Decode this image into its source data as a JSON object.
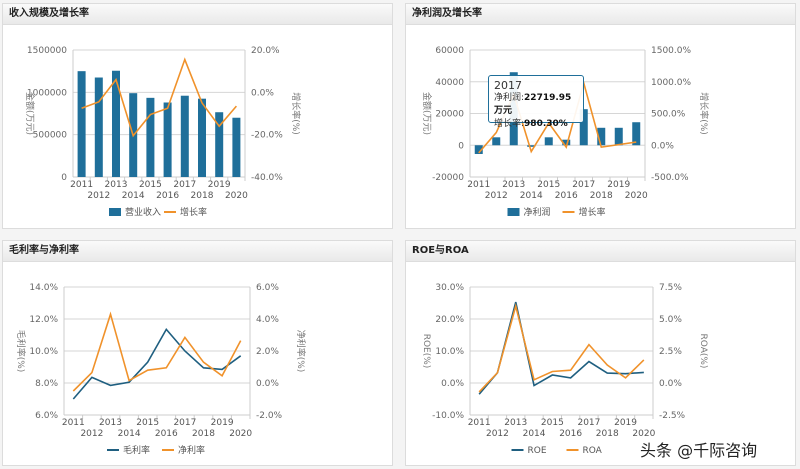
{
  "panels": [
    {
      "title": "收入规模及增长率"
    },
    {
      "title": "净利润及增长率"
    },
    {
      "title": "毛利率与净利率"
    },
    {
      "title": "ROE与ROA"
    }
  ],
  "colors": {
    "bar": "#1f6f9a",
    "line1": "#1f5f80",
    "line2": "#f0922b"
  },
  "chart_data": [
    {
      "type": "bar+line",
      "categories": [
        "2011",
        "2012",
        "2013",
        "2014",
        "2015",
        "2016",
        "2017",
        "2018",
        "2019",
        "2020"
      ],
      "ylabel": "金额(万元)",
      "y2label": "增长率(%)",
      "ylim": [
        0,
        1500000
      ],
      "yticks": [
        "0",
        "500000",
        "1000000",
        "1500000"
      ],
      "y2lim": [
        -40,
        20
      ],
      "y2ticks": [
        "-40.0%",
        "-20.0%",
        "0.0%",
        "20.0%"
      ],
      "legend": "bottom",
      "series": [
        {
          "name": "营业收入",
          "type": "bar",
          "axis": "left",
          "values": [
            1250000,
            1175000,
            1255000,
            990000,
            935000,
            880000,
            960000,
            925000,
            765000,
            700000
          ]
        },
        {
          "name": "增长率",
          "type": "line",
          "axis": "right",
          "values": [
            -7.5,
            -4.5,
            6,
            -20.5,
            -10.5,
            -7.5,
            15.5,
            -5,
            -16,
            -6.5
          ]
        }
      ]
    },
    {
      "type": "bar+line",
      "categories": [
        "2011",
        "2012",
        "2013",
        "2014",
        "2015",
        "2016",
        "2017",
        "2018",
        "2019",
        "2020"
      ],
      "ylabel": "金额(万元)",
      "y2label": "增长率(%)",
      "ylim": [
        -20000,
        60000
      ],
      "yticks": [
        "-20000",
        "0",
        "20000",
        "40000",
        "60000"
      ],
      "y2lim": [
        -500,
        1500
      ],
      "y2ticks": [
        "-500.0%",
        "0.0%",
        "500.0%",
        "1000.0%",
        "1500.0%"
      ],
      "legend": "bottom",
      "series": [
        {
          "name": "净利润",
          "type": "bar",
          "axis": "left",
          "values": [
            -5500,
            5000,
            46000,
            -1000,
            5000,
            3500,
            22719.95,
            11000,
            11000,
            14500
          ]
        },
        {
          "name": "增长率",
          "type": "line",
          "axis": "right",
          "values": [
            -120,
            200,
            800,
            -100,
            350,
            -30,
            980.3,
            -30,
            10,
            50
          ]
        }
      ],
      "tooltip": {
        "year": "2017",
        "line1_label": "净利润:",
        "line1_value": "22719.95万元",
        "line2_label": "增长率:",
        "line2_value": "980.30%"
      }
    },
    {
      "type": "line",
      "categories": [
        "2011",
        "2012",
        "2013",
        "2014",
        "2015",
        "2016",
        "2017",
        "2018",
        "2019",
        "2020"
      ],
      "ylabel": "毛利率(%)",
      "y2label": "净利率(%)",
      "ylim": [
        6,
        14
      ],
      "yticks": [
        "6.0%",
        "8.0%",
        "10.0%",
        "12.0%",
        "14.0%"
      ],
      "y2lim": [
        -2,
        6
      ],
      "y2ticks": [
        "-2.0%",
        "0.0%",
        "2.0%",
        "4.0%",
        "6.0%"
      ],
      "legend": "bottom",
      "series": [
        {
          "name": "毛利率",
          "type": "line",
          "axis": "left",
          "values": [
            7.0,
            8.35,
            7.85,
            8.05,
            9.3,
            11.35,
            10.0,
            8.95,
            8.85,
            9.7
          ]
        },
        {
          "name": "净利率",
          "type": "line",
          "axis": "right",
          "values": [
            -0.5,
            0.65,
            4.3,
            0.15,
            0.8,
            0.95,
            2.85,
            1.3,
            0.45,
            2.65
          ]
        }
      ]
    },
    {
      "type": "line",
      "categories": [
        "2011",
        "2012",
        "2013",
        "2014",
        "2015",
        "2016",
        "2017",
        "2018",
        "2019",
        "2020"
      ],
      "ylabel": "ROE(%)",
      "y2label": "ROA(%)",
      "ylim": [
        -10,
        30
      ],
      "yticks": [
        "-10.0%",
        "0.0%",
        "10.0%",
        "20.0%",
        "30.0%"
      ],
      "y2lim": [
        -2.5,
        7.5
      ],
      "y2ticks": [
        "-2.5%",
        "0.0%",
        "2.5%",
        "5.0%",
        "7.5%"
      ],
      "legend": "bottom",
      "series": [
        {
          "name": "ROE",
          "type": "line",
          "axis": "left",
          "values": [
            -3.5,
            3.2,
            25.3,
            -0.8,
            2.5,
            1.6,
            6.7,
            3.1,
            2.9,
            3.3
          ]
        },
        {
          "name": "ROA",
          "type": "line",
          "axis": "right",
          "values": [
            -0.7,
            0.8,
            6.0,
            0.25,
            0.9,
            1.0,
            3.0,
            1.4,
            0.4,
            1.8
          ]
        }
      ]
    }
  ],
  "watermark": "头条 @千际咨询"
}
